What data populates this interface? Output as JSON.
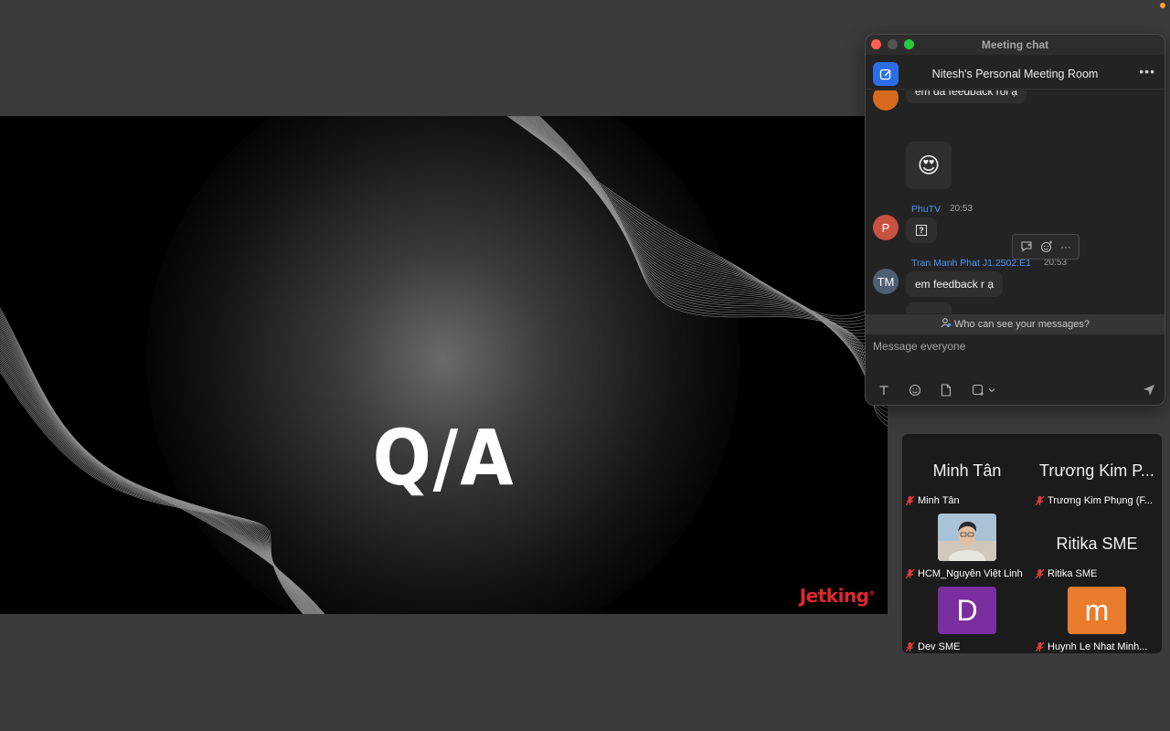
{
  "share": {
    "slide_title": "Q/A",
    "brand": "Jetking"
  },
  "chat": {
    "window_title": "Meeting chat",
    "room_name": "Nitesh's Personal Meeting Room",
    "messages": [
      {
        "text": "em đã feedback rồi ạ",
        "emoji": "😍"
      },
      {
        "sender": "PhuTV",
        "initial": "P",
        "time": "20:53",
        "text": "?"
      },
      {
        "sender": "Tran Manh Phat J1.2502.E1",
        "initial": "TM",
        "time": "20:53",
        "text": "em feedback r ạ",
        "emoji": "🤡"
      }
    ],
    "who_can_see": "Who can see your messages?",
    "input_placeholder": "Message everyone"
  },
  "gallery": {
    "tiles": [
      {
        "display": "Minh Tân",
        "label": "Minh Tân"
      },
      {
        "display": "Trương Kim P...",
        "label": "Trương Kim Phụng (F..."
      },
      {
        "label": "HCM_Nguyễn Việt Linh"
      },
      {
        "display": "Ritika SME",
        "label": "Ritika SME"
      },
      {
        "letter": "D",
        "label": "Dev SME"
      },
      {
        "letter": "m",
        "label": "Huynh Le Nhat Minh..."
      }
    ]
  },
  "colors": {
    "accent": "#2d6ee8",
    "sender_name": "#4b93f3",
    "brand_red": "#e2262e"
  }
}
